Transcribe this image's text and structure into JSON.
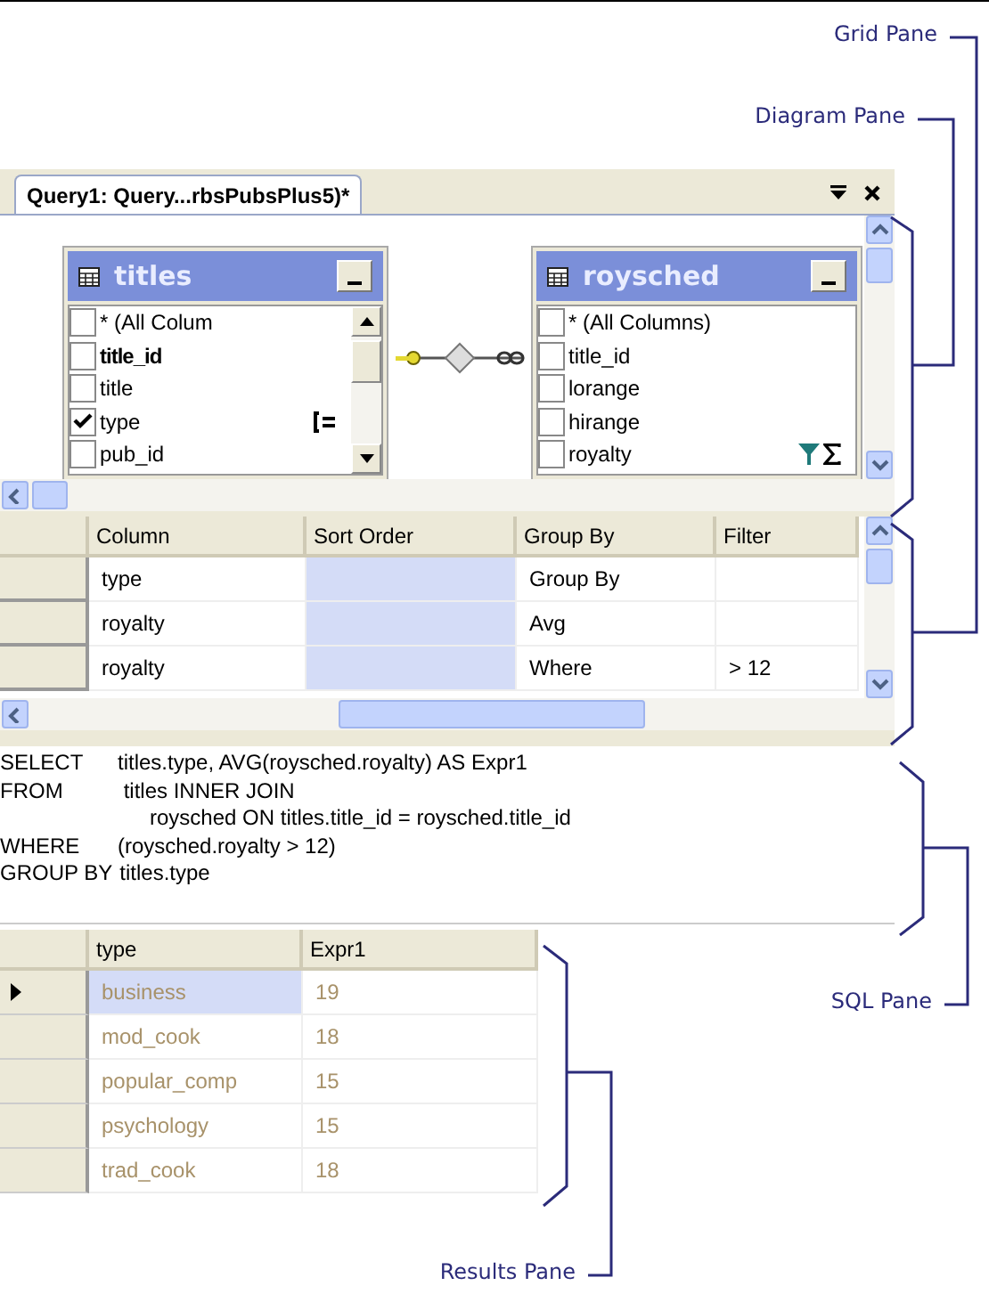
{
  "callouts": [
    {
      "label": "Grid Pane"
    },
    {
      "label": "Diagram Pane"
    },
    {
      "label": "SQL Pane"
    },
    {
      "label": "Results Pane"
    }
  ],
  "tabs": [
    {
      "label": "Query1: Query...rbsPubsPlus5)*",
      "selected": true
    }
  ],
  "diagram": {
    "tables": [
      {
        "name": "titles",
        "columns": [
          {
            "name": "* (All Colum",
            "checked": false,
            "primary_key": false,
            "grouped": false,
            "filtered": false,
            "aggregated": false
          },
          {
            "name": "title_id",
            "checked": false,
            "primary_key": true,
            "grouped": false,
            "filtered": false,
            "aggregated": false
          },
          {
            "name": "title",
            "checked": false,
            "primary_key": false,
            "grouped": false,
            "filtered": false,
            "aggregated": false
          },
          {
            "name": "type",
            "checked": true,
            "primary_key": false,
            "grouped": true,
            "filtered": false,
            "aggregated": false
          },
          {
            "name": "pub_id",
            "checked": false,
            "primary_key": false,
            "grouped": false,
            "filtered": false,
            "aggregated": false
          }
        ]
      },
      {
        "name": "roysched",
        "columns": [
          {
            "name": "* (All Columns)",
            "checked": false,
            "primary_key": false,
            "grouped": false,
            "filtered": false,
            "aggregated": false
          },
          {
            "name": "title_id",
            "checked": false,
            "primary_key": false,
            "grouped": false,
            "filtered": false,
            "aggregated": false
          },
          {
            "name": "lorange",
            "checked": false,
            "primary_key": false,
            "grouped": false,
            "filtered": false,
            "aggregated": false
          },
          {
            "name": "hirange",
            "checked": false,
            "primary_key": false,
            "grouped": false,
            "filtered": false,
            "aggregated": false
          },
          {
            "name": "royalty",
            "checked": false,
            "primary_key": false,
            "grouped": false,
            "filtered": true,
            "aggregated": true
          }
        ]
      }
    ]
  },
  "grid": {
    "columns": [
      {
        "label": "Column",
        "selected": false
      },
      {
        "label": "Sort Order",
        "selected": true
      },
      {
        "label": "Group By",
        "selected": false
      },
      {
        "label": "Filter",
        "selected": false
      }
    ],
    "rows": [
      {
        "cells": [
          "type",
          null,
          "Group By",
          null
        ]
      },
      {
        "cells": [
          "royalty",
          null,
          "Avg",
          null
        ]
      },
      {
        "cells": [
          "royalty",
          null,
          "Where",
          "> 12"
        ]
      }
    ]
  },
  "sql": [
    {
      "keyword": "SELECT",
      "text": "titles.type, AVG(roysched.royalty) AS Expr1"
    },
    {
      "keyword": "FROM",
      "text": " titles INNER JOIN"
    },
    {
      "text": "roysched ON titles.title_id = roysched.title_id"
    },
    {
      "keyword": "WHERE",
      "text": "(roysched.royalty > 12)"
    },
    {
      "keyword": "GROUP BY",
      "text": "titles.type"
    }
  ],
  "results": {
    "columns": [
      "type",
      "Expr1"
    ],
    "rows": [
      {
        "type": "business",
        "expr1": "19",
        "selected": true
      },
      {
        "type": "mod_cook",
        "expr1": "18",
        "selected": false
      },
      {
        "type": "popular_comp",
        "expr1": "15",
        "selected": false
      },
      {
        "type": "psychology",
        "expr1": "15",
        "selected": false
      },
      {
        "type": "trad_cook",
        "expr1": "18",
        "selected": false
      }
    ]
  }
}
